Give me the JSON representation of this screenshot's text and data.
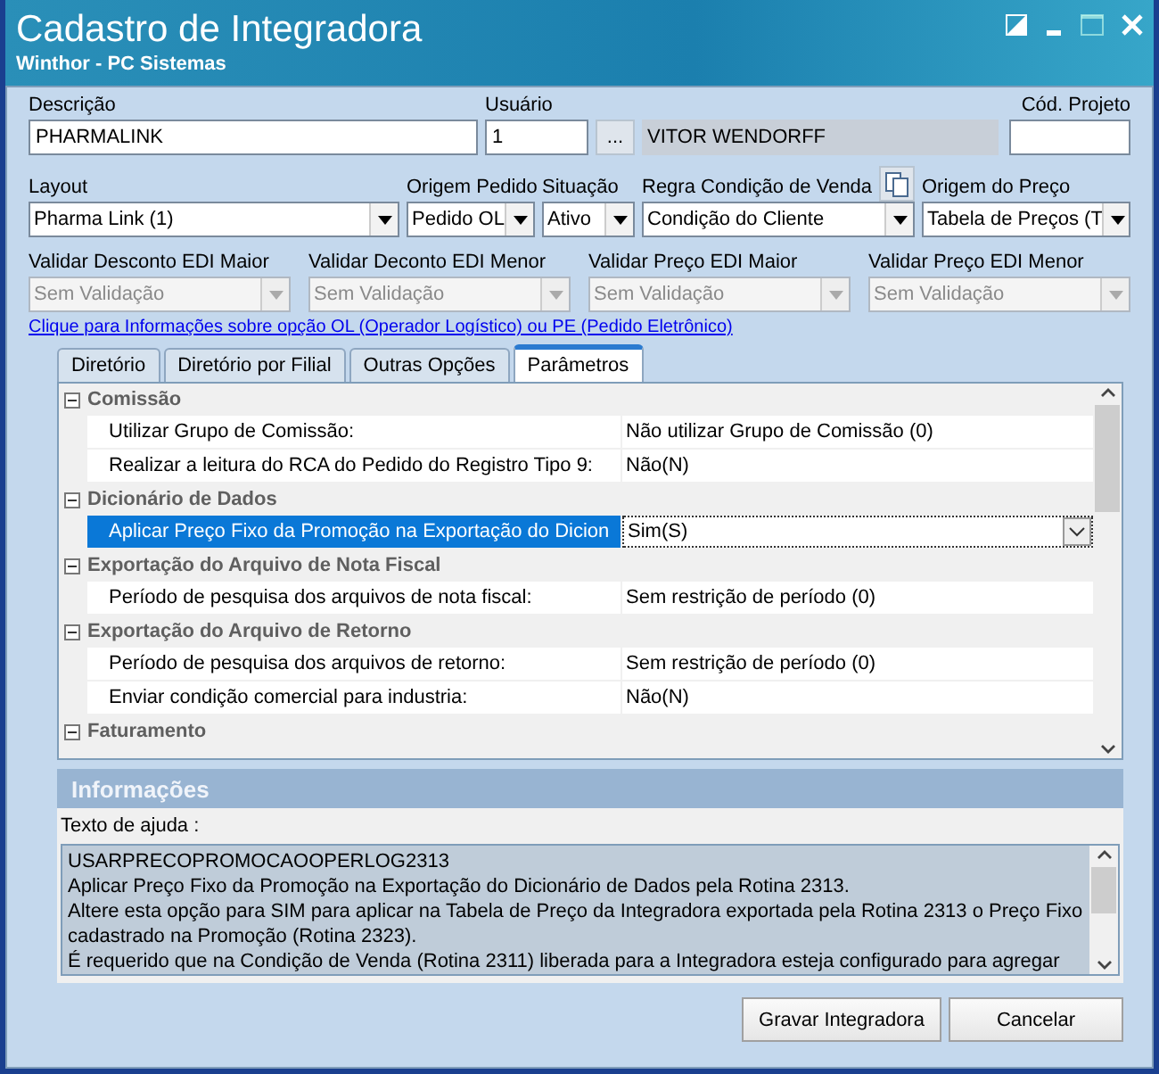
{
  "window": {
    "title": "Cadastro de Integradora",
    "subtitle": "Winthor - PC Sistemas"
  },
  "header_fields": {
    "descricao": {
      "label": "Descrição",
      "value": "PHARMALINK"
    },
    "usuario": {
      "label": "Usuário",
      "value": "1",
      "lookup": "...",
      "name": "VITOR WENDORFF"
    },
    "cod_projeto": {
      "label": "Cód. Projeto"
    }
  },
  "selects": [
    {
      "label": "Layout",
      "value": "Pharma Link (1)"
    },
    {
      "label": "Origem Pedido",
      "value": "Pedido OL"
    },
    {
      "label": "Situação",
      "value": "Ativo"
    },
    {
      "label": "Regra Condição de Venda",
      "value": "Condição do Cliente"
    },
    {
      "label": "Origem do Preço",
      "value": "Tabela de Preços (T"
    }
  ],
  "validations": [
    {
      "label": "Validar Desconto EDI Maior",
      "value": "Sem Validação",
      "disabled": true
    },
    {
      "label": "Validar Deconto EDI Menor",
      "value": "Sem Validação",
      "disabled": true
    },
    {
      "label": "Validar Preço EDI Maior",
      "value": "Sem Validação",
      "disabled": true
    },
    {
      "label": "Validar Preço EDI Menor",
      "value": "Sem Validação",
      "disabled": true
    }
  ],
  "info_link": "Clique para Informações sobre opção OL (Operador Logístico) ou PE (Pedido Eletrônico)",
  "tabs": [
    {
      "label": "Diretório",
      "selected": false
    },
    {
      "label": "Diretório por Filial",
      "selected": false
    },
    {
      "label": "Outras Opções",
      "selected": false
    },
    {
      "label": "Parâmetros",
      "selected": true
    }
  ],
  "grid": [
    {
      "title": "Comissão",
      "expanded": true,
      "rows": [
        {
          "label": "Utilizar Grupo de Comissão:",
          "value": "Não utilizar Grupo de Comissão (0)",
          "selected": false
        },
        {
          "label": "Realizar a leitura do RCA do Pedido do Registro Tipo 9:",
          "value": "Não(N)",
          "selected": false
        }
      ]
    },
    {
      "title": "Dicionário de Dados",
      "expanded": true,
      "rows": [
        {
          "label": "Aplicar Preço Fixo da Promoção na Exportação do Dicion",
          "value": "Sim(S)",
          "selected": true
        }
      ]
    },
    {
      "title": "Exportação do Arquivo de Nota Fiscal",
      "expanded": true,
      "rows": [
        {
          "label": "Período de pesquisa dos arquivos de nota fiscal:",
          "value": "Sem restrição de período (0)",
          "selected": false
        }
      ]
    },
    {
      "title": "Exportação do Arquivo de Retorno",
      "expanded": true,
      "rows": [
        {
          "label": "Período de pesquisa dos arquivos de retorno:",
          "value": "Sem restrição de período (0)",
          "selected": false
        },
        {
          "label": "Enviar condição comercial para industria:",
          "value": "Não(N)",
          "selected": false
        }
      ]
    },
    {
      "title": "Faturamento",
      "expanded": true
    }
  ],
  "info": {
    "header": "Informações",
    "help_label": "Texto de ajuda :",
    "help_lines": [
      "USARPRECOPROMOCAOOPERLOG2313",
      "Aplicar Preço Fixo da Promoção na Exportação do Dicionário de Dados pela Rotina 2313.",
      "Altere esta opção para SIM para aplicar na Tabela de Preço da Integradora exportada pela Rotina 2313 o Preço Fixo cadastrado na Promoção (Rotina 2323).",
      "É requerido que na Condição de Venda (Rotina 2311) liberada para a Integradora esteja configurado para agregar"
    ]
  },
  "buttons": [
    "Gravar Integradora",
    "Cancelar"
  ]
}
